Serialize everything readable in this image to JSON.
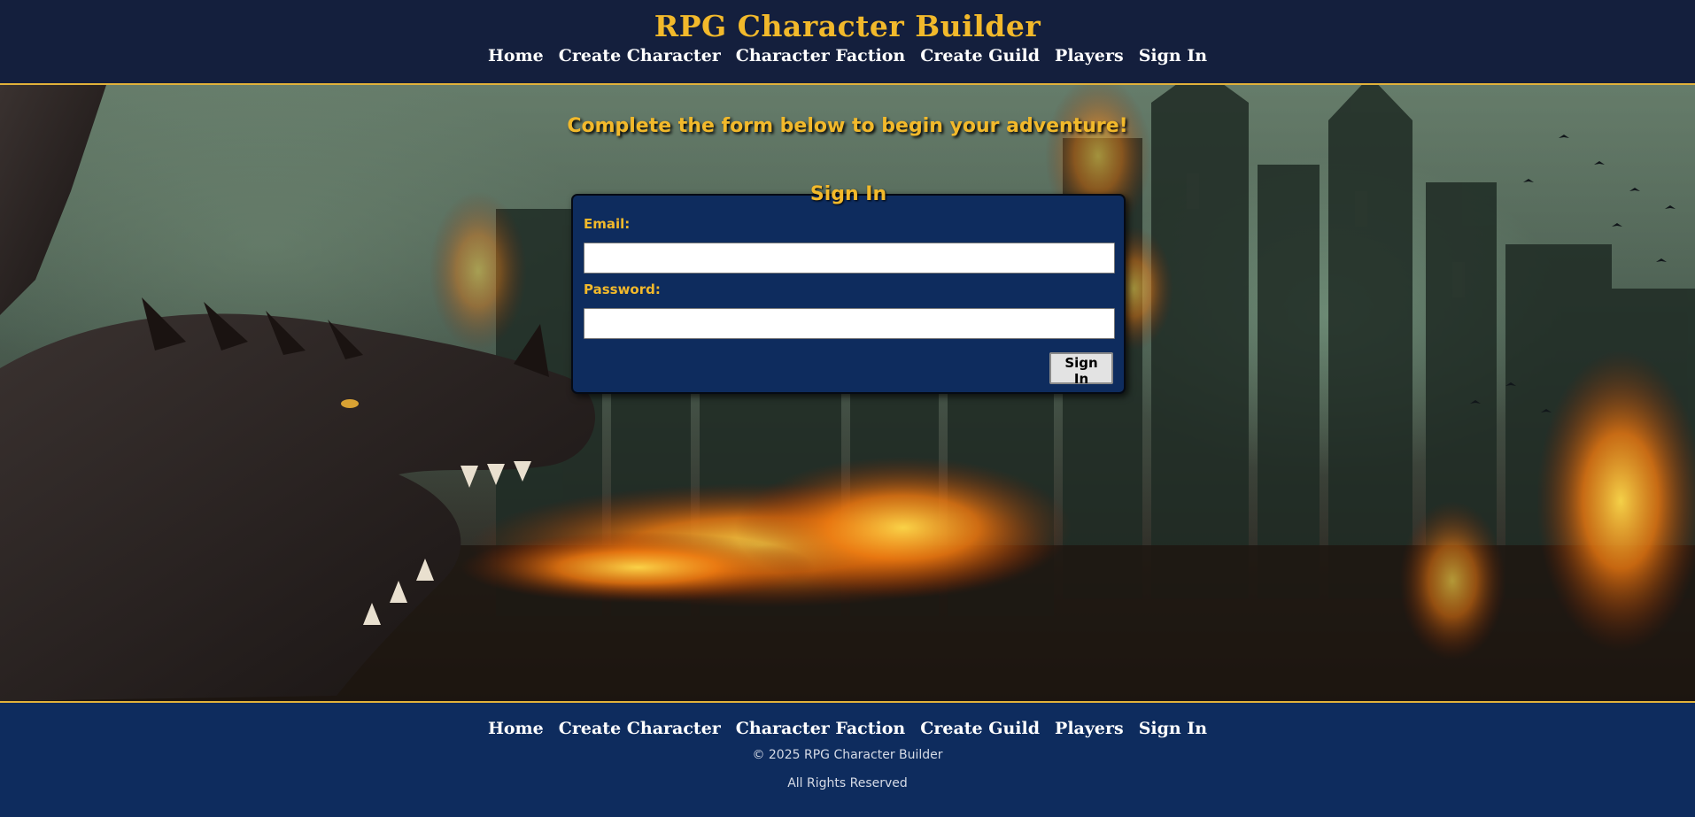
{
  "site": {
    "title": "RPG Character Builder"
  },
  "nav": {
    "items": [
      {
        "label": "Home"
      },
      {
        "label": "Create Character"
      },
      {
        "label": "Character Faction"
      },
      {
        "label": "Create Guild"
      },
      {
        "label": "Players"
      },
      {
        "label": "Sign In"
      }
    ]
  },
  "hero": {
    "tagline": "Complete the form below to begin your adventure!"
  },
  "signin": {
    "heading": "Sign In",
    "email_label": "Email:",
    "email_value": "",
    "password_label": "Password:",
    "password_value": "",
    "submit_label": "Sign In"
  },
  "footer": {
    "copyright": "© 2025 RPG Character Builder",
    "rights": "All Rights Reserved"
  },
  "colors": {
    "header_bg": "#141f3d",
    "brand_gold": "#f2b92b",
    "card_bg": "#0e2c5e",
    "footer_bg": "#0e2c5e"
  }
}
